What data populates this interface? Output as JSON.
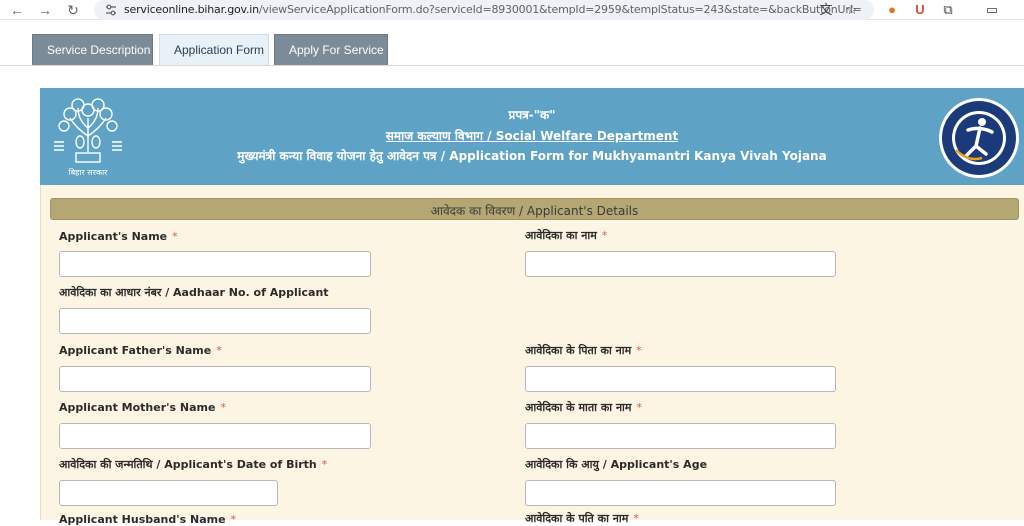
{
  "browser": {
    "url_host": "serviceonline.bihar.gov.in",
    "url_path": "/viewServiceApplicationForm.do?serviceId=8930001&tempId=2959&templStatus=243&state=&backButtonUrl="
  },
  "tabs": [
    {
      "label": "Service Description"
    },
    {
      "label": "Application Form"
    },
    {
      "label": "Apply For Service"
    }
  ],
  "header": {
    "line1": "प्रपत्र-\"क\"",
    "line2": "समाज कल्याण विभाग / Social Welfare Department",
    "line3": "मुख्यमंत्री कन्या विवाह योजना हेतु आवेदन पत्र / Application Form for Mukhyamantri Kanya Vivah Yojana",
    "left_logo_caption": "बिहार सरकार"
  },
  "section": {
    "title": "आवेदक का विवरण / Applicant's Details"
  },
  "fields": {
    "applicant_name": {
      "label": "Applicant's Name",
      "required": "*"
    },
    "applicant_name_hi": {
      "label": "आवेदिका का नाम",
      "required": "*"
    },
    "aadhaar": {
      "label": "आवेदिका का आधार नंबर / Aadhaar No. of Applicant"
    },
    "father_name": {
      "label": "Applicant Father's Name",
      "required": "*"
    },
    "father_name_hi": {
      "label": "आवेदिका के पिता का नाम",
      "required": "*"
    },
    "mother_name": {
      "label": "Applicant Mother's Name",
      "required": "*"
    },
    "mother_name_hi": {
      "label": "आवेदिका के माता का नाम",
      "required": "*"
    },
    "dob": {
      "label": "आवेदिका की जन्मतिथि / Applicant's Date of Birth",
      "required": "*"
    },
    "age": {
      "label": "आवेदिका कि आयु / Applicant's Age"
    },
    "husband_name": {
      "label": "Applicant Husband's Name",
      "required": "*"
    },
    "husband_name_hi": {
      "label": "आवेदिका के पति का नाम",
      "required": "*"
    }
  },
  "colors": {
    "header_band": "#5ea3c6",
    "section_bar": "#b5a774",
    "form_bg": "#fdf5e4",
    "required": "#d9534f"
  }
}
